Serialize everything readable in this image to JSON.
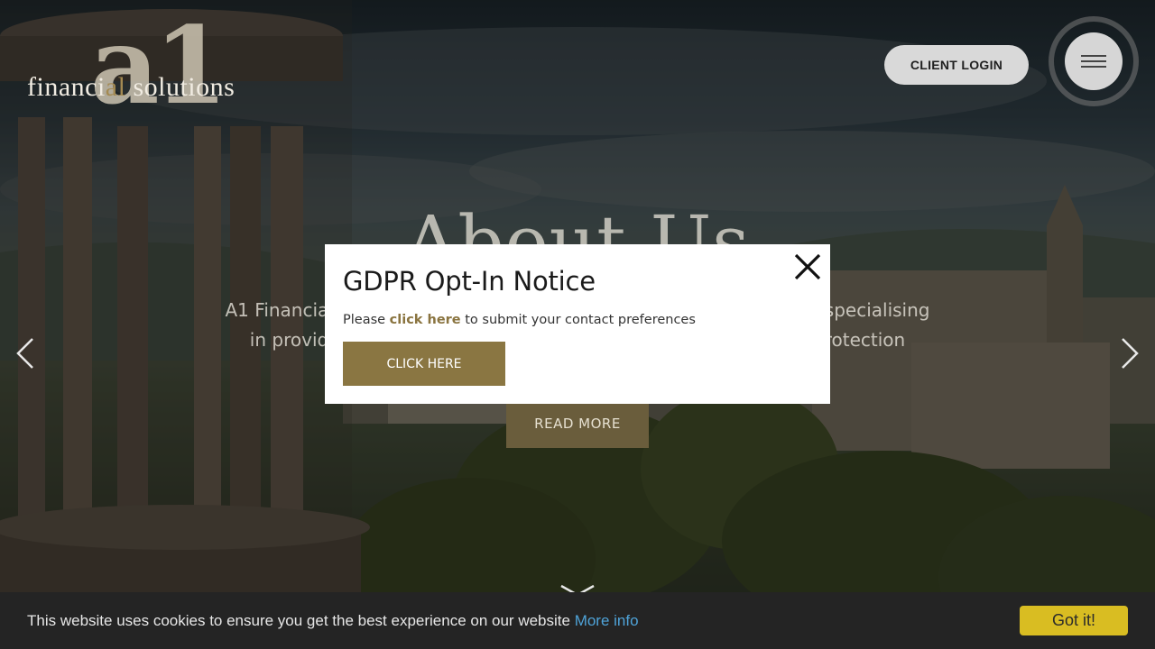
{
  "header": {
    "logo_mark": "a1",
    "logo_text_part1": "financi",
    "logo_text_accent": "al",
    "logo_text_part2": " solutions",
    "client_login_label": "CLIENT LOGIN",
    "menu_icon": "hamburger-icon"
  },
  "hero": {
    "title": "About Us",
    "line1": "A1 Financial Solutions is an independent firm of financial advisers specialising",
    "line2": "in providing advice on investments, pensions, mortgages and protection",
    "read_more_label": "READ MORE",
    "prev_icon": "chevron-left-icon",
    "next_icon": "chevron-right-icon",
    "scroll_icon": "chevron-down-icon"
  },
  "modal": {
    "title": "GDPR Opt-In Notice",
    "body_prefix": "Please ",
    "body_link": "click here",
    "body_suffix": " to submit your contact preferences",
    "cta_label": "CLICK HERE",
    "close_icon": "close-icon"
  },
  "cookie_bar": {
    "message": "This website uses cookies to ensure you get the best experience on our website ",
    "more_info_label": "More info",
    "accept_label": "Got it!"
  },
  "colors": {
    "accent_gold": "#8a7642",
    "link_gold": "#8a7440",
    "cookie_button": "#d9bd22",
    "cookie_link": "#4fa3d8"
  }
}
